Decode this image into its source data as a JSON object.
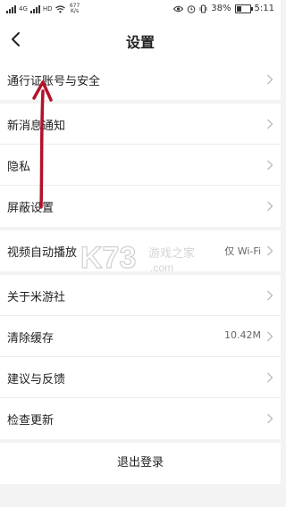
{
  "status_bar": {
    "carrier_tags": [
      "4G",
      "HD"
    ],
    "speed": "677 K/s",
    "battery": "38%",
    "battery_level": 0.38,
    "time": "5:11",
    "icons": [
      "signal-icon",
      "wifi-icon",
      "eye-icon",
      "alarm-icon",
      "vibrate-icon",
      "battery-icon"
    ]
  },
  "header": {
    "title": "设置"
  },
  "groups": [
    {
      "items": [
        {
          "label": "通行证账号与安全",
          "value": ""
        }
      ]
    },
    {
      "items": [
        {
          "label": "新消息通知",
          "value": ""
        },
        {
          "label": "隐私",
          "value": ""
        },
        {
          "label": "屏蔽设置",
          "value": ""
        }
      ]
    },
    {
      "items": [
        {
          "label": "视频自动播放",
          "value": "仅 Wi-Fi"
        }
      ]
    },
    {
      "items": [
        {
          "label": "关于米游社",
          "value": ""
        },
        {
          "label": "清除缓存",
          "value": "10.42M"
        },
        {
          "label": "建议与反馈",
          "value": ""
        },
        {
          "label": "检查更新",
          "value": ""
        }
      ]
    }
  ],
  "logout_label": "退出登录",
  "watermark": {
    "logo": "K73",
    "text": "游戏之家",
    "sub": ".com"
  },
  "colors": {
    "background": "#f3f3f3",
    "row": "#ffffff",
    "annotation_arrow": "#b3122b",
    "watermark": "#d8d8d8"
  }
}
